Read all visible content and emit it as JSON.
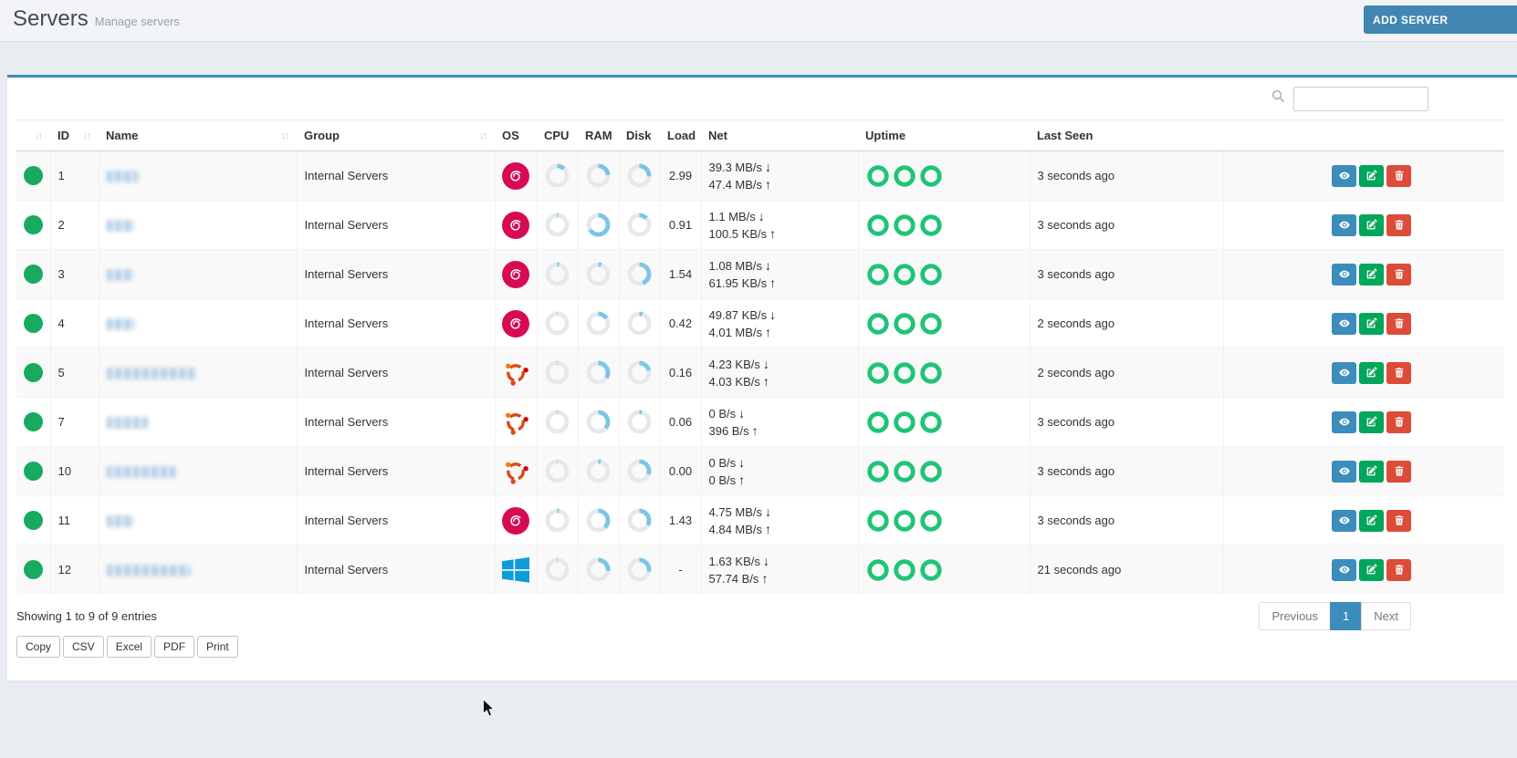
{
  "page": {
    "title": "Servers",
    "subtitle": "Manage servers"
  },
  "header": {
    "add_server_label": "ADD SERVER"
  },
  "search": {
    "value": "",
    "placeholder": ""
  },
  "table": {
    "columns": [
      {
        "label": "",
        "sortable": true,
        "key": "status"
      },
      {
        "label": "ID",
        "sortable": true,
        "key": "id"
      },
      {
        "label": "Name",
        "sortable": true,
        "key": "name"
      },
      {
        "label": "Group",
        "sortable": true,
        "key": "group"
      },
      {
        "label": "OS",
        "sortable": false,
        "key": "os"
      },
      {
        "label": "CPU",
        "sortable": false,
        "key": "cpu"
      },
      {
        "label": "RAM",
        "sortable": false,
        "key": "ram"
      },
      {
        "label": "Disk",
        "sortable": false,
        "key": "disk"
      },
      {
        "label": "Load",
        "sortable": false,
        "key": "load"
      },
      {
        "label": "Net",
        "sortable": false,
        "key": "net"
      },
      {
        "label": "Uptime",
        "sortable": false,
        "key": "uptime"
      },
      {
        "label": "Last Seen",
        "sortable": false,
        "key": "last_seen"
      },
      {
        "label": "",
        "sortable": false,
        "key": "actions"
      }
    ],
    "rows": [
      {
        "id": "1",
        "status": "online",
        "name_redacted_width": 34,
        "group": "Internal Servers",
        "os": "debian",
        "cpu_pct": 12,
        "ram_pct": 24,
        "disk_pct": 26,
        "load": "2.99",
        "net_down": "39.3 MB/s",
        "net_up": "47.4 MB/s",
        "uptime_rings": 3,
        "last_seen": "3 seconds ago"
      },
      {
        "id": "2",
        "status": "online",
        "name_redacted_width": 30,
        "group": "Internal Servers",
        "os": "debian",
        "cpu_pct": 2,
        "ram_pct": 66,
        "disk_pct": 13,
        "load": "0.91",
        "net_down": "1.1 MB/s",
        "net_up": "100.5 KB/s",
        "uptime_rings": 3,
        "last_seen": "3 seconds ago"
      },
      {
        "id": "3",
        "status": "online",
        "name_redacted_width": 30,
        "group": "Internal Servers",
        "os": "debian",
        "cpu_pct": 3,
        "ram_pct": 5,
        "disk_pct": 44,
        "load": "1.54",
        "net_down": "1.08 MB/s",
        "net_up": "61.95 KB/s",
        "uptime_rings": 3,
        "last_seen": "3 seconds ago"
      },
      {
        "id": "4",
        "status": "online",
        "name_redacted_width": 31,
        "group": "Internal Servers",
        "os": "debian",
        "cpu_pct": 1,
        "ram_pct": 16,
        "disk_pct": 5,
        "load": "0.42",
        "net_down": "49.87 KB/s",
        "net_up": "4.01 MB/s",
        "uptime_rings": 3,
        "last_seen": "2 seconds ago"
      },
      {
        "id": "5",
        "status": "online",
        "name_redacted_width": 98,
        "group": "Internal Servers",
        "os": "ubuntu",
        "cpu_pct": 1,
        "ram_pct": 34,
        "disk_pct": 21,
        "load": "0.16",
        "net_down": "4.23 KB/s",
        "net_up": "4.03 KB/s",
        "uptime_rings": 3,
        "last_seen": "2 seconds ago"
      },
      {
        "id": "7",
        "status": "online",
        "name_redacted_width": 45,
        "group": "Internal Servers",
        "os": "ubuntu",
        "cpu_pct": 1,
        "ram_pct": 36,
        "disk_pct": 4,
        "load": "0.06",
        "net_down": "0 B/s",
        "net_up": "396 B/s",
        "uptime_rings": 3,
        "last_seen": "3 seconds ago"
      },
      {
        "id": "10",
        "status": "online",
        "name_redacted_width": 76,
        "group": "Internal Servers",
        "os": "ubuntu",
        "cpu_pct": 1,
        "ram_pct": 4,
        "disk_pct": 30,
        "load": "0.00",
        "net_down": "0 B/s",
        "net_up": "0 B/s",
        "uptime_rings": 3,
        "last_seen": "3 seconds ago"
      },
      {
        "id": "11",
        "status": "online",
        "name_redacted_width": 30,
        "group": "Internal Servers",
        "os": "debian",
        "cpu_pct": 3,
        "ram_pct": 38,
        "disk_pct": 33,
        "load": "1.43",
        "net_down": "4.75 MB/s",
        "net_up": "4.84 MB/s",
        "uptime_rings": 3,
        "last_seen": "3 seconds ago"
      },
      {
        "id": "12",
        "status": "online",
        "name_redacted_width": 92,
        "group": "Internal Servers",
        "os": "windows",
        "cpu_pct": 1,
        "ram_pct": 27,
        "disk_pct": 28,
        "load": "-",
        "net_down": "1.63 KB/s",
        "net_up": "57.74 B/s",
        "uptime_rings": 3,
        "last_seen": "21 seconds ago"
      }
    ],
    "row_actions": [
      "view",
      "edit",
      "delete"
    ],
    "net_down_arrow": "↓",
    "net_up_arrow": "↑",
    "sort_glyph": "↓↑"
  },
  "footer": {
    "showing": "Showing 1 to 9 of 9 entries",
    "export_buttons": [
      "Copy",
      "CSV",
      "Excel",
      "PDF",
      "Print"
    ],
    "pagination": {
      "previous": "Previous",
      "current": "1",
      "next": "Next"
    }
  },
  "colors": {
    "accent_blue": "#3c8dbc",
    "button_green": "#00a65a",
    "button_red": "#dd4b39",
    "status_green": "#18ab5f",
    "uptime_green": "#1fc476",
    "gauge_fill": "#7cc5e8",
    "gauge_track": "#e6e9ec",
    "debian_red": "#d70a53",
    "ubuntu_orange": "#dd4814",
    "windows_blue": "#0d9dd9",
    "panel_border_blue": "#3c8dbc"
  }
}
